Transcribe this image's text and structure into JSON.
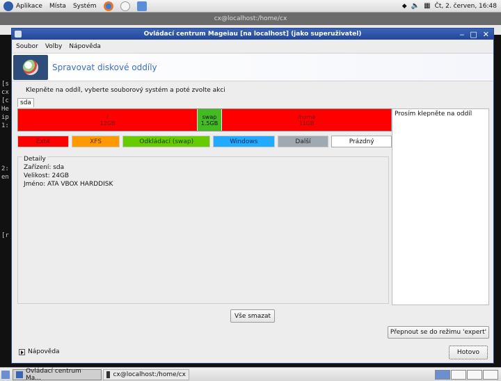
{
  "top_panel": {
    "apps_label": "Aplikace",
    "places_label": "Místa",
    "system_label": "Systém",
    "clock": "Čt,  2. červen, 16:48"
  },
  "terminal": {
    "title": "cx@localhost:/home/cx",
    "lines": [
      "[s",
      "cx",
      "[c",
      "He",
      "ip",
      "1:",
      "2:",
      "en",
      "[r"
    ]
  },
  "window": {
    "title": "Ovládací centrum Mageiau  [na localhost] (jako superuživatel)",
    "menu": {
      "file": "Soubor",
      "options": "Volby",
      "help": "Nápověda"
    },
    "banner_title": "Spravovat diskové oddíly",
    "instruction": "Klepněte na oddíl, vyberte souborový systém a poté zvolte akci",
    "tab": "sda",
    "partitions": [
      {
        "mount": "/",
        "size": "12GB",
        "color": "#ff0000"
      },
      {
        "mount": "swap",
        "size": "1.5GB",
        "color": "#44bb22"
      },
      {
        "mount": "/home",
        "size": "11GB",
        "color": "#ff0000"
      }
    ],
    "legend": [
      {
        "label": "Ext4",
        "color": "#ff0000"
      },
      {
        "label": "XFS",
        "color": "#ff9900"
      },
      {
        "label": "Odkládací (swap)",
        "color": "#66cc00"
      },
      {
        "label": "Windows",
        "color": "#22aaff"
      },
      {
        "label": "Další",
        "color": "#a0a8b0"
      },
      {
        "label": "Prázdný",
        "color": "#ffffff"
      }
    ],
    "details": {
      "title": "Detaily",
      "device": "Zařízení: sda",
      "size": "Velikost: 24GB",
      "name": "Jméno: ATA VBOX HARDDISK"
    },
    "info_text": "Prosím klepněte na oddíl",
    "clear_all": "Vše smazat",
    "expert_mode": "Přepnout se do režimu 'expert'",
    "help": "Nápověda",
    "done": "Hotovo"
  },
  "taskbar": {
    "tasks": [
      "Ovládací centrum Ma...",
      "cx@localhost:/home/cx"
    ]
  }
}
